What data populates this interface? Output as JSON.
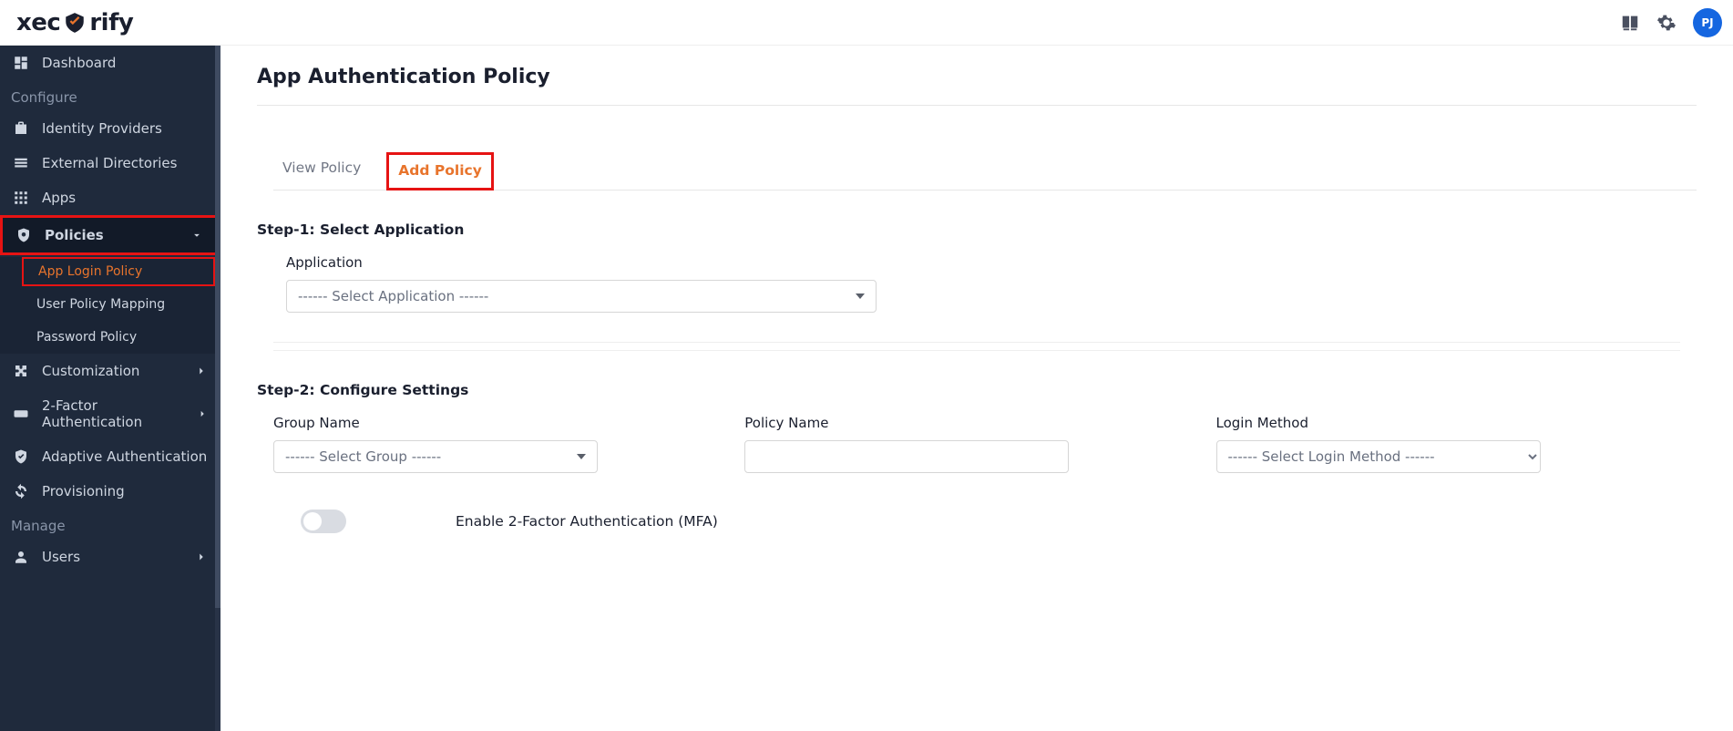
{
  "brand": {
    "p1": "xec",
    "p2": "rify"
  },
  "header": {
    "avatar": "PJ"
  },
  "sidebar": {
    "dashboard": "Dashboard",
    "section_configure": "Configure",
    "idp": "Identity Providers",
    "ext_dir": "External Directories",
    "apps": "Apps",
    "policies": "Policies",
    "sub_app_login": "App Login Policy",
    "sub_user_policy": "User Policy Mapping",
    "sub_password": "Password Policy",
    "customization": "Customization",
    "two_factor": "2-Factor Authentication",
    "adaptive": "Adaptive Authentication",
    "provisioning": "Provisioning",
    "section_manage": "Manage",
    "users": "Users"
  },
  "page": {
    "title": "App Authentication Policy"
  },
  "tabs": {
    "view": "View Policy",
    "add": "Add Policy"
  },
  "step1": {
    "title": "Step-1: Select Application",
    "app_label": "Application",
    "app_placeholder": "------ Select Application ------"
  },
  "step2": {
    "title": "Step-2: Configure Settings",
    "group_label": "Group Name",
    "group_placeholder": "------ Select Group ------",
    "policy_label": "Policy Name",
    "login_label": "Login Method",
    "login_placeholder": "------ Select Login Method ------",
    "mfa_label": "Enable 2-Factor Authentication (MFA)"
  }
}
